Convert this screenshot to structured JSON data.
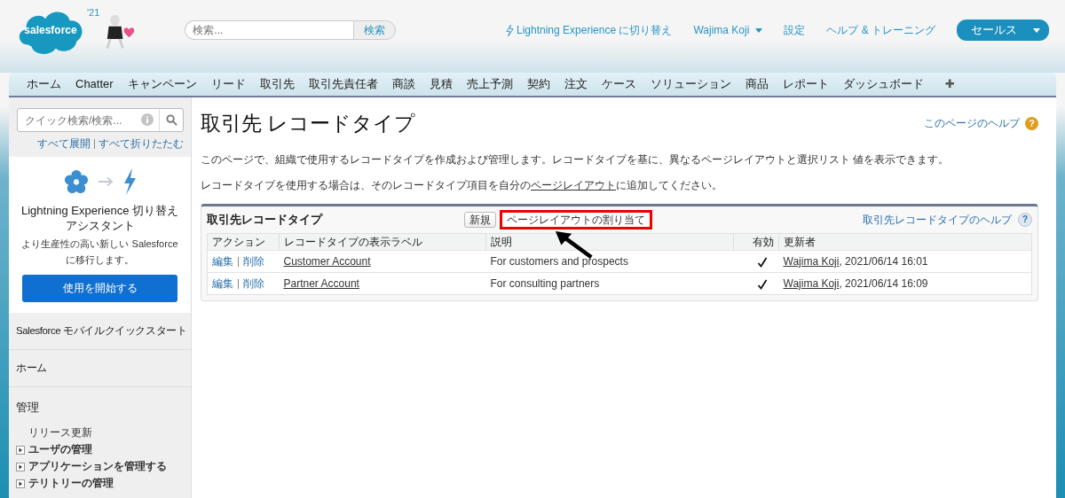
{
  "header": {
    "logo_text": "salesforce",
    "year_badge": "'21",
    "search": {
      "placeholder": "検索...",
      "button": "検索"
    },
    "links": [
      {
        "kind": "lightning",
        "label": "Lightning Experience に切り替え"
      },
      {
        "kind": "user",
        "label": "Wajima Koji"
      },
      {
        "kind": "plain",
        "label": "設定"
      },
      {
        "kind": "plain",
        "label": "ヘルプ & トレーニング"
      }
    ],
    "app_menu": "セールス"
  },
  "tabs": [
    {
      "label": "ホーム",
      "selected": false
    },
    {
      "label": "Chatter",
      "selected": false
    },
    {
      "label": "キャンペーン",
      "selected": false
    },
    {
      "label": "リード",
      "selected": false
    },
    {
      "label": "取引先",
      "selected": false
    },
    {
      "label": "取引先責任者",
      "selected": false
    },
    {
      "label": "商談",
      "selected": false
    },
    {
      "label": "見積",
      "selected": false
    },
    {
      "label": "売上予測",
      "selected": false
    },
    {
      "label": "契約",
      "selected": false
    },
    {
      "label": "注文",
      "selected": false
    },
    {
      "label": "ケース",
      "selected": false
    },
    {
      "label": "ソリューション",
      "selected": false
    },
    {
      "label": "商品",
      "selected": false
    },
    {
      "label": "レポート",
      "selected": false
    },
    {
      "label": "ダッシュボード",
      "selected": false
    }
  ],
  "add_tab": "✚",
  "sidebar": {
    "quick_search": {
      "placeholder": "クイック検索/検索..."
    },
    "expand_all": "すべて展開",
    "collapse_all": "すべて折りたたむ",
    "promo": {
      "title": "Lightning Experience 切り替えアシスタント",
      "text": "より生産性の高い新しい Salesforce に移行します。",
      "button": "使用を開始する"
    },
    "sections": [
      "Salesforce モバイルクイックスタート",
      "ホーム"
    ],
    "admin": {
      "title": "管理",
      "items": [
        {
          "kind": "leaf",
          "label": "リリース更新"
        },
        {
          "kind": "folder",
          "label": "ユーザの管理"
        },
        {
          "kind": "folder",
          "label": "アプリケーションを管理する"
        },
        {
          "kind": "folder",
          "label": "テリトリーの管理"
        }
      ]
    }
  },
  "page": {
    "title": "取引先 レコードタイプ",
    "help": "このページのヘルプ",
    "help_icon": "?",
    "intro": "このページで、組織で使用するレコードタイプを作成および管理します。レコードタイプを基に、異なるページレイアウトと選択リスト 値を表示できます。",
    "note_before": "レコードタイプを使用する場合は、そのレコードタイプ項目を自分の",
    "note_link": "ページレイアウト",
    "note_after": "に追加してください。"
  },
  "related_list": {
    "title": "取引先レコードタイプ",
    "buttons": [
      {
        "label": "新規",
        "highlighted": false
      },
      {
        "label": "ページレイアウトの割り当て",
        "highlighted": true
      }
    ],
    "help": "取引先レコードタイプのヘルプ",
    "help_icon": "?",
    "columns": [
      "アクション",
      "レコードタイプの表示ラベル",
      "説明",
      "有効",
      "更新者"
    ],
    "rows": [
      {
        "edit": "編集",
        "delete": "削除",
        "label": "Customer Account",
        "description": "For customers and prospects",
        "active": true,
        "modified_by": "Wajima Koji",
        "modified_at": ", 2021/06/14 16:01"
      },
      {
        "edit": "編集",
        "delete": "削除",
        "label": "Partner Account",
        "description": "For consulting partners",
        "active": true,
        "modified_by": "Wajima Koji",
        "modified_at": ", 2021/06/14 16:09"
      }
    ]
  }
}
